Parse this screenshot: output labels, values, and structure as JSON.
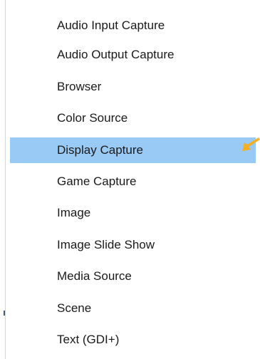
{
  "menu": {
    "items": [
      {
        "label": "Audio Input Capture"
      },
      {
        "label": "Audio Output Capture"
      },
      {
        "label": "Browser"
      },
      {
        "label": "Color Source"
      },
      {
        "label": "Display Capture",
        "selected": true
      },
      {
        "label": "Game Capture"
      },
      {
        "label": "Image"
      },
      {
        "label": "Image Slide Show"
      },
      {
        "label": "Media Source"
      },
      {
        "label": "Scene"
      },
      {
        "label": "Text (GDI+)"
      }
    ]
  },
  "colors": {
    "selected_background": "#99c9f5",
    "text": "#1a1a1a",
    "annotation_arrow": "#f5b021"
  },
  "annotation": {
    "icon": "arrow-pointer-icon"
  }
}
